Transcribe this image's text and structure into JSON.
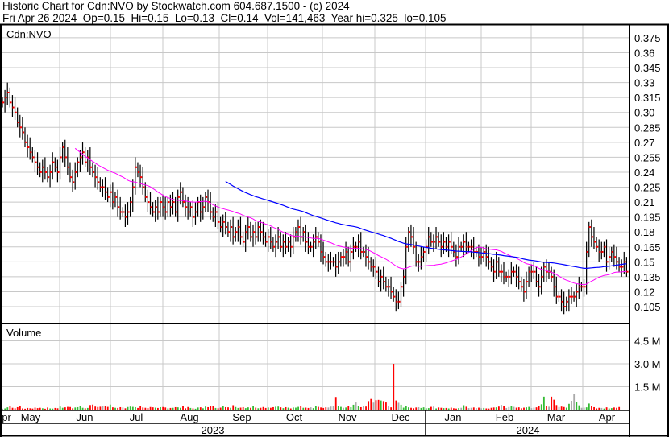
{
  "header": {
    "title": "Historic Chart for Cdn:NVO by Stockwatch.com 604.687.1500 - (c) 2024",
    "quote": "Fri Apr 26 2024  Op=0.15  Hi=0.15  Lo=0.13  Cl=0.14  Vol=141,463  Year hi=0.325  lo=0.105"
  },
  "price_pane_label": "Cdn:NVO",
  "volume_pane_label": "Volume",
  "colors": {
    "bar": "#000000",
    "close_tick": "#ff0000",
    "ma_short": "#ff00ff",
    "ma_long": "#0000ff",
    "vol_up": "#33bb33",
    "vol_down": "#ff0000",
    "vol_flat": "#aaaaaa",
    "grid": "#c8c8c8"
  },
  "chart_data": {
    "type": "ohlc",
    "title": "Historic Chart for Cdn:NVO",
    "ylim": [
      0.095,
      0.39
    ],
    "price_ticks": [
      "0.375",
      "0.36",
      "0.345",
      "0.33",
      "0.315",
      "0.30",
      "0.285",
      "0.27",
      "0.255",
      "0.24",
      "0.225",
      "0.21",
      "0.195",
      "0.18",
      "0.165",
      "0.15",
      "0.135",
      "0.12",
      "0.105"
    ],
    "volume_ticks": [
      "4.5 M",
      "3.0 M",
      "1.5 M"
    ],
    "volume_tick_values": [
      4500,
      3000,
      1500
    ],
    "volume_unit": "thousands",
    "months": [
      "pr",
      "May",
      "Jun",
      "Jul",
      "Aug",
      "Sep",
      "Oct",
      "Nov",
      "Dec",
      "Jan",
      "Feb",
      "Mar",
      "Apr"
    ],
    "years": [
      "2023",
      "2024"
    ],
    "ma_periods": [
      30,
      90
    ],
    "close": [
      0.31,
      0.315,
      0.32,
      0.31,
      0.305,
      0.3,
      0.29,
      0.285,
      0.28,
      0.27,
      0.265,
      0.26,
      0.255,
      0.25,
      0.245,
      0.24,
      0.245,
      0.24,
      0.235,
      0.24,
      0.25,
      0.245,
      0.24,
      0.255,
      0.265,
      0.255,
      0.245,
      0.235,
      0.23,
      0.24,
      0.25,
      0.255,
      0.26,
      0.25,
      0.255,
      0.245,
      0.24,
      0.235,
      0.23,
      0.225,
      0.225,
      0.22,
      0.215,
      0.22,
      0.21,
      0.215,
      0.205,
      0.2,
      0.2,
      0.195,
      0.2,
      0.21,
      0.225,
      0.245,
      0.24,
      0.235,
      0.225,
      0.215,
      0.21,
      0.205,
      0.2,
      0.205,
      0.2,
      0.21,
      0.205,
      0.2,
      0.21,
      0.205,
      0.21,
      0.2,
      0.215,
      0.22,
      0.21,
      0.205,
      0.2,
      0.205,
      0.195,
      0.2,
      0.21,
      0.2,
      0.205,
      0.215,
      0.21,
      0.2,
      0.195,
      0.2,
      0.19,
      0.185,
      0.19,
      0.185,
      0.18,
      0.185,
      0.175,
      0.18,
      0.185,
      0.175,
      0.17,
      0.18,
      0.185,
      0.175,
      0.18,
      0.175,
      0.185,
      0.18,
      0.175,
      0.17,
      0.175,
      0.17,
      0.165,
      0.17,
      0.175,
      0.165,
      0.17,
      0.165,
      0.17,
      0.165,
      0.175,
      0.18,
      0.185,
      0.175,
      0.18,
      0.17,
      0.165,
      0.165,
      0.17,
      0.175,
      0.17,
      0.16,
      0.155,
      0.15,
      0.15,
      0.15,
      0.15,
      0.145,
      0.15,
      0.155,
      0.155,
      0.16,
      0.15,
      0.16,
      0.165,
      0.165,
      0.17,
      0.16,
      0.16,
      0.155,
      0.15,
      0.145,
      0.145,
      0.14,
      0.13,
      0.135,
      0.13,
      0.125,
      0.125,
      0.12,
      0.115,
      0.11,
      0.11,
      0.125,
      0.135,
      0.165,
      0.18,
      0.175,
      0.165,
      0.15,
      0.15,
      0.155,
      0.16,
      0.165,
      0.175,
      0.17,
      0.17,
      0.175,
      0.17,
      0.165,
      0.17,
      0.165,
      0.17,
      0.165,
      0.16,
      0.155,
      0.165,
      0.165,
      0.17,
      0.165,
      0.165,
      0.165,
      0.16,
      0.16,
      0.155,
      0.155,
      0.16,
      0.155,
      0.15,
      0.145,
      0.14,
      0.15,
      0.14,
      0.14,
      0.135,
      0.135,
      0.135,
      0.14,
      0.14,
      0.135,
      0.13,
      0.125,
      0.12,
      0.13,
      0.14,
      0.14,
      0.14,
      0.13,
      0.125,
      0.135,
      0.145,
      0.14,
      0.14,
      0.135,
      0.125,
      0.115,
      0.115,
      0.11,
      0.105,
      0.11,
      0.115,
      0.115,
      0.115,
      0.12,
      0.125,
      0.125,
      0.125,
      0.16,
      0.185,
      0.175,
      0.17,
      0.165,
      0.16,
      0.16,
      0.165,
      0.15,
      0.155,
      0.16,
      0.155,
      0.15,
      0.145,
      0.145,
      0.15,
      0.14
    ],
    "volume": [
      60,
      80,
      150,
      230,
      120,
      90,
      160,
      210,
      80,
      60,
      110,
      90,
      70,
      130,
      100,
      120,
      90,
      60,
      140,
      80,
      70,
      110,
      90,
      200,
      120,
      150,
      180,
      170,
      90,
      140,
      160,
      260,
      120,
      90,
      110,
      300,
      330,
      200,
      170,
      190,
      220,
      250,
      180,
      330,
      150,
      120,
      110,
      160,
      140,
      90,
      170,
      200,
      180,
      160,
      110,
      220,
      140,
      120,
      100,
      170,
      150,
      130,
      110,
      160,
      170,
      140,
      80,
      110,
      120,
      160,
      150,
      120,
      230,
      90,
      170,
      110,
      80,
      60,
      140,
      150,
      90,
      200,
      160,
      260,
      220,
      110,
      90,
      130,
      230,
      160,
      150,
      120,
      290,
      170,
      110,
      130,
      160,
      100,
      150,
      120,
      210,
      130,
      90,
      120,
      170,
      110,
      140,
      120,
      160,
      190,
      200,
      150,
      100,
      160,
      130,
      80,
      140,
      130,
      180,
      240,
      120,
      130,
      110,
      150,
      100,
      220,
      180,
      140,
      110,
      150,
      140,
      200,
      250,
      830,
      240,
      180,
      120,
      140,
      260,
      160,
      320,
      470,
      250,
      160,
      250,
      200,
      560,
      700,
      460,
      620,
      640,
      600,
      560,
      470,
      250,
      150,
      3000,
      600,
      450,
      320,
      130,
      250,
      150,
      120,
      90,
      140,
      160,
      110,
      150,
      90,
      100,
      180,
      200,
      80,
      140,
      120,
      100,
      110,
      80,
      130,
      90,
      70,
      100,
      120,
      290,
      190,
      100,
      120,
      140,
      100,
      130,
      90,
      110,
      80,
      70,
      120,
      140,
      150,
      200,
      310,
      250,
      110,
      170,
      220,
      180,
      130,
      150,
      90,
      130,
      150,
      180,
      100,
      130,
      150,
      220,
      350,
      850,
      250,
      190,
      850,
      650,
      300,
      170,
      200,
      170,
      130,
      380,
      580,
      1000,
      500,
      280,
      120,
      130,
      150,
      400,
      220,
      160,
      80,
      120,
      110,
      70,
      150,
      80,
      100,
      140,
      120,
      170
    ]
  }
}
